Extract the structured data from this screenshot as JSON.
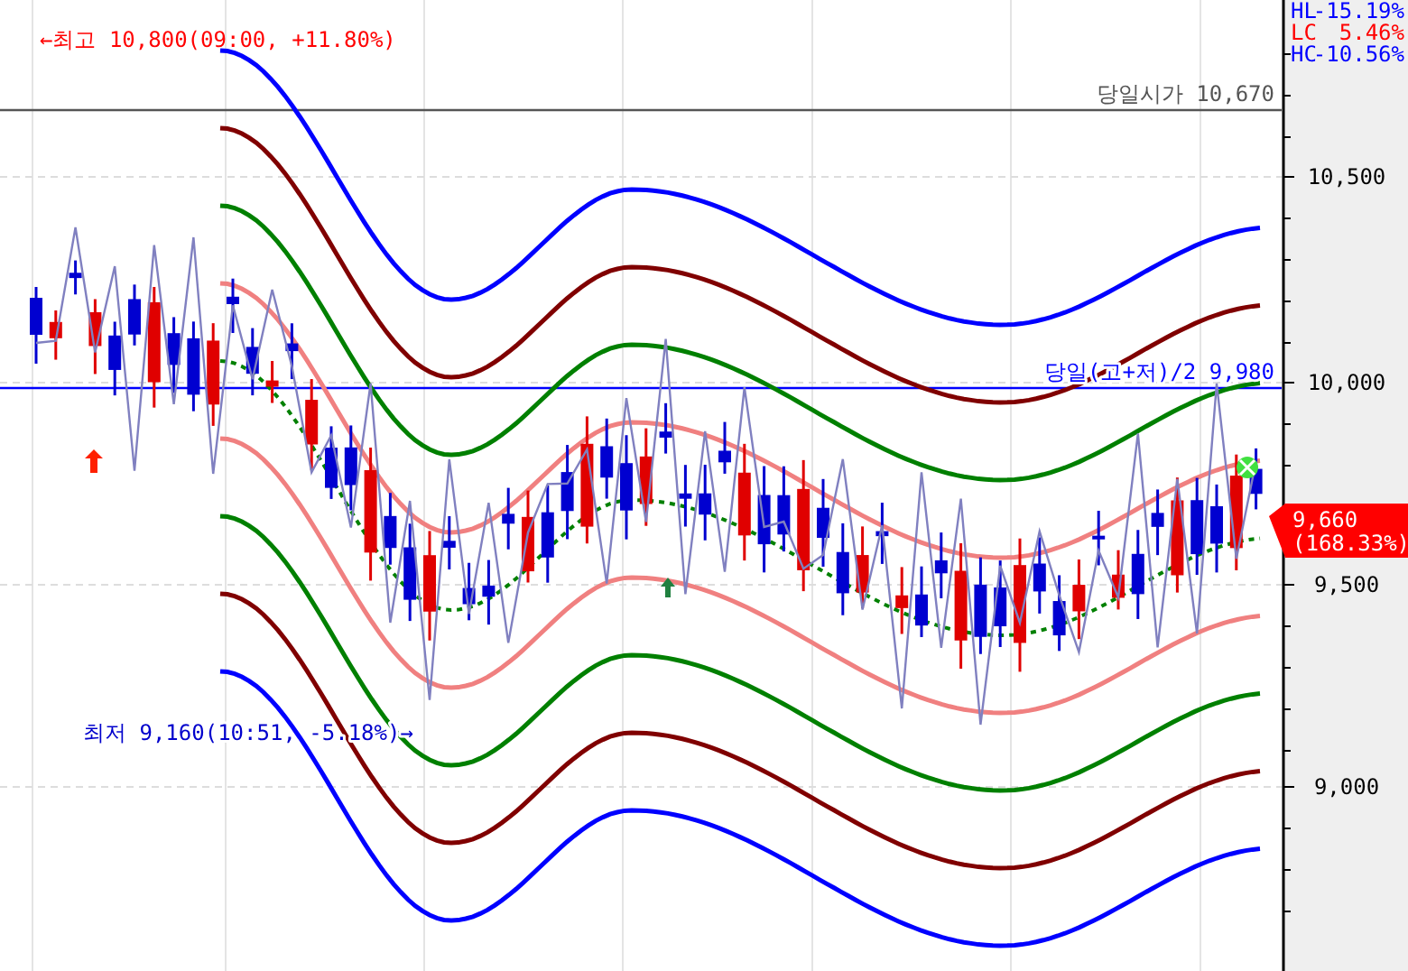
{
  "summary": [
    {
      "label": "HL",
      "value": "-15.19%",
      "color": "#0000ff"
    },
    {
      "label": "LC",
      "value": "5.46%",
      "color": "#ff0000"
    },
    {
      "label": "HC",
      "value": "-10.56%",
      "color": "#0000ff"
    }
  ],
  "annotations": [
    {
      "kind": "high",
      "text": "←최고 10,800(09:00, +11.80%)"
    },
    {
      "kind": "open",
      "text": "당일시가 10,670"
    },
    {
      "kind": "mid",
      "text": "당일(고+저)/2 9,980"
    },
    {
      "kind": "low",
      "text": "최저 9,160(10:51, -5.18%)→"
    }
  ],
  "y_axis": {
    "ticks": [
      "10,500",
      "10,000",
      "9,500",
      "9,000"
    ]
  },
  "current_price": {
    "price": "9,660",
    "change": "(168.33%)"
  }
}
